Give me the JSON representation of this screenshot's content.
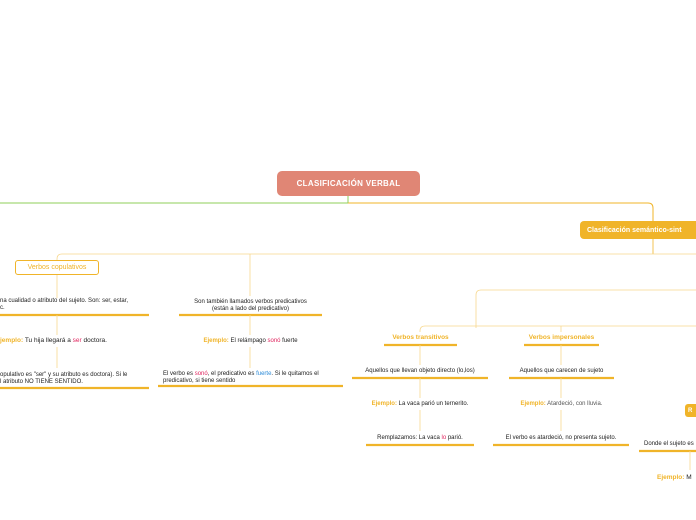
{
  "root": {
    "title": "CLASIFICACIÓN VERBAL"
  },
  "main_branch": {
    "title": "Clasificación semántico-sint"
  },
  "copulativos": {
    "title": "Verbos copulativos",
    "desc": "na cualidad o atributo del sujeto. Son: ser, estar,",
    "desc2": "c.",
    "example_label": "jemplo:",
    "example_pre": " Tu hija llegará a ",
    "example_verb": "ser",
    "example_post": " doctora.",
    "note1": "opulativo es \"ser\" y su atributo es doctora). Si le",
    "note2": "l atributo NO TIENE SENTIDO."
  },
  "predicativos": {
    "desc1": "Son también llamados verbos predicativos",
    "desc2": "(están a lado del predicativo)",
    "example_label": "Ejemplo:",
    "example_pre": " El relámpago ",
    "example_verb": "sonó",
    "example_post": " fuerte",
    "note_pre": "El verbo es ",
    "note_verb": "sonó",
    "note_mid": ", el predicativo es ",
    "note_pred": "fuerte",
    "note_post": ". Si le quitamos el",
    "note2": "predicativo, si tiene sentido"
  },
  "transitivos": {
    "title": "Verbos transitivos",
    "desc": "Aquellos que llevan objeto directo (lo,los)",
    "example_label": "Ejemplo:",
    "example": " La vaca parió un ternerito.",
    "replace_pre": "Remplazamos: La vaca ",
    "replace_obj": "lo",
    "replace_post": " parió."
  },
  "impersonales": {
    "title": "Verbos impersonales",
    "desc": "Aquellos que carecen de sujeto",
    "example_label": "Ejemplo:",
    "example": " Atardeció, con lluvia.",
    "note": "El verbo es atardeció, no presenta sujeto."
  },
  "reflexivos": {
    "badge": "R",
    "desc": "Donde el sujeto es",
    "example_label": "Ejemplo:",
    "example": " M"
  }
}
